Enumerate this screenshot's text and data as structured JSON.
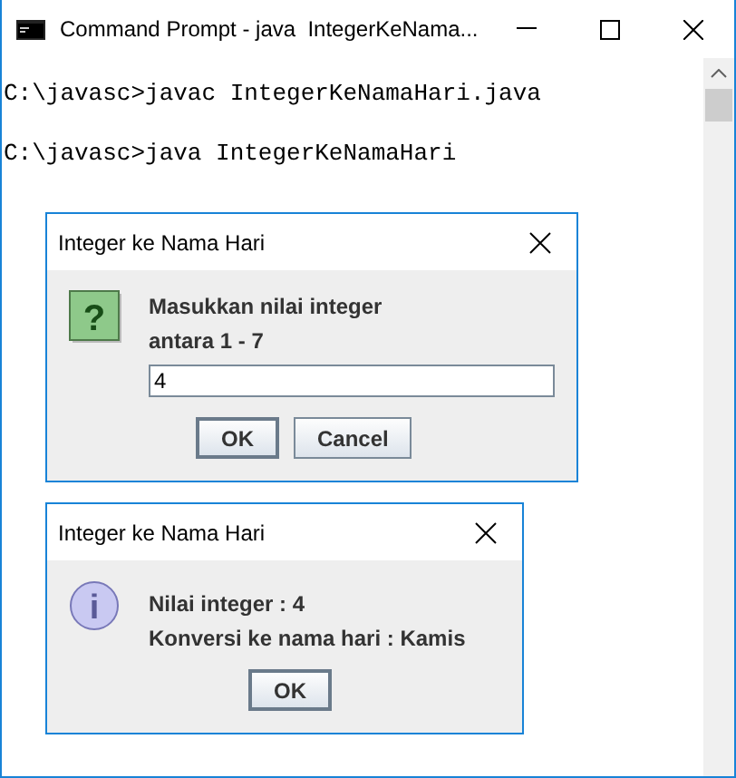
{
  "window": {
    "title": "Command Prompt - java  IntegerKeNama...",
    "console_lines": [
      "C:\\javasc>javac IntegerKeNamaHari.java",
      "C:\\javasc>java IntegerKeNamaHari"
    ]
  },
  "dialogs": [
    {
      "title": "Integer ke Nama Hari",
      "kind": "question",
      "icon_glyph": "?",
      "message_lines": [
        "Masukkan nilai integer",
        "antara 1 - 7"
      ],
      "input": {
        "value": "4"
      },
      "buttons": [
        {
          "label": "OK",
          "focused": true
        },
        {
          "label": "Cancel",
          "focused": false
        }
      ]
    },
    {
      "title": "Integer ke Nama Hari",
      "kind": "information",
      "icon_glyph": "i",
      "message_lines": [
        "Nilai integer : 4",
        "Konversi ke nama hari : Kamis"
      ],
      "buttons": [
        {
          "label": "OK",
          "focused": true
        }
      ]
    }
  ]
}
